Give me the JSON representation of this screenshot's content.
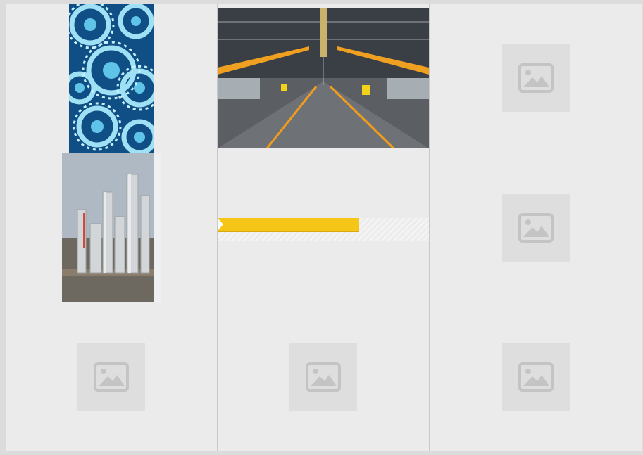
{
  "tiles": [
    {
      "name": "gears",
      "image": "blue-gears-image"
    },
    {
      "name": "factory",
      "image": "factory-assembly-line-image"
    },
    {
      "name": "placeholder-1",
      "image": "image-placeholder-icon"
    },
    {
      "name": "refinery",
      "image": "refinery-plant-image"
    },
    {
      "name": "loading",
      "progress": 0.67
    },
    {
      "name": "placeholder-2",
      "image": "image-placeholder-icon"
    },
    {
      "name": "placeholder-3",
      "image": "image-placeholder-icon"
    },
    {
      "name": "placeholder-4",
      "image": "image-placeholder-icon"
    },
    {
      "name": "placeholder-5",
      "image": "image-placeholder-icon"
    }
  ],
  "colors": {
    "progress_fill": "#f5c518",
    "placeholder": "#dedede",
    "panel": "#ebebeb"
  }
}
